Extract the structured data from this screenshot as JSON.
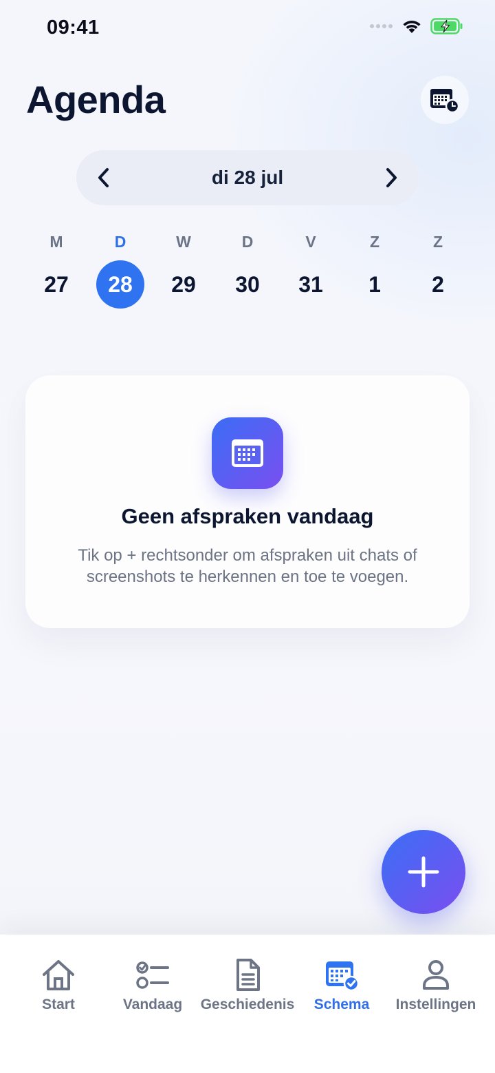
{
  "status_bar": {
    "time": "09:41",
    "icons": [
      "signal-dots-icon",
      "wifi-icon",
      "battery-charging-icon"
    ]
  },
  "header": {
    "title": "Agenda",
    "calendar_button_icon": "calendar-clock-icon"
  },
  "date_nav": {
    "label": "di 28 jul",
    "prev_icon": "chevron-left-icon",
    "next_icon": "chevron-right-icon"
  },
  "week": {
    "days": [
      {
        "dow": "M",
        "num": "27",
        "selected": false
      },
      {
        "dow": "D",
        "num": "28",
        "selected": true
      },
      {
        "dow": "W",
        "num": "29",
        "selected": false
      },
      {
        "dow": "D",
        "num": "30",
        "selected": false
      },
      {
        "dow": "V",
        "num": "31",
        "selected": false
      },
      {
        "dow": "Z",
        "num": "1",
        "selected": false
      },
      {
        "dow": "Z",
        "num": "2",
        "selected": false
      }
    ]
  },
  "empty_state": {
    "icon": "calendar-icon",
    "title": "Geen afspraken vandaag",
    "text": "Tik op + rechtsonder om afspraken uit chats of screenshots te herkennen en toe te voegen."
  },
  "fab": {
    "icon": "plus-icon"
  },
  "tab_bar": {
    "tabs": [
      {
        "label": "Start",
        "icon": "home-icon",
        "active": false
      },
      {
        "label": "Vandaag",
        "icon": "checklist-icon",
        "active": false
      },
      {
        "label": "Geschiedenis",
        "icon": "document-icon",
        "active": false
      },
      {
        "label": "Schema",
        "icon": "calendar-check-icon",
        "active": true
      },
      {
        "label": "Instellingen",
        "icon": "person-icon",
        "active": false
      }
    ]
  },
  "colors": {
    "accent": "#2f73f0",
    "gradient_start": "#3b6df5",
    "gradient_end": "#7a4ff0",
    "title_text": "#0c1630",
    "muted_text": "#6b7384",
    "battery": "#4cd964"
  }
}
